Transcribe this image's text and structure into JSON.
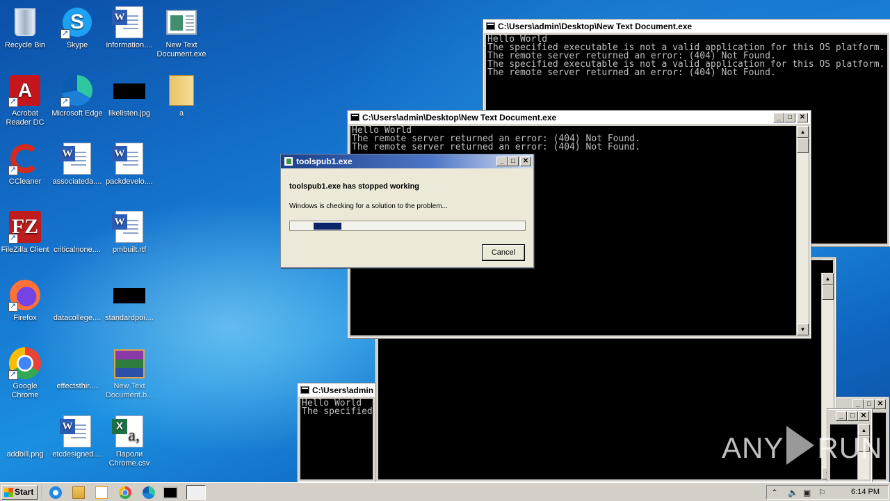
{
  "desktop": {
    "icons": [
      {
        "label": "Recycle Bin",
        "icon": "recycle-bin-icon"
      },
      {
        "label": "Skype",
        "icon": "skype-icon"
      },
      {
        "label": "information....",
        "icon": "word-document-icon"
      },
      {
        "label": "New Text Document.exe",
        "icon": "executable-icon"
      },
      {
        "label": "Acrobat Reader DC",
        "icon": "acrobat-icon"
      },
      {
        "label": "Microsoft Edge",
        "icon": "edge-icon"
      },
      {
        "label": "likelisten.jpg",
        "icon": "image-icon"
      },
      {
        "label": "a",
        "icon": "folder-icon"
      },
      {
        "label": "CCleaner",
        "icon": "ccleaner-icon"
      },
      {
        "label": "associateda....",
        "icon": "word-document-icon"
      },
      {
        "label": "packdevelo....",
        "icon": "word-document-icon"
      },
      {
        "label": "FileZilla Client",
        "icon": "filezilla-icon"
      },
      {
        "label": "criticalnone....",
        "icon": "blank-file-icon"
      },
      {
        "label": "pmbuilt.rtf",
        "icon": "word-document-icon"
      },
      {
        "label": "Firefox",
        "icon": "firefox-icon"
      },
      {
        "label": "datacollege....",
        "icon": "blank-file-icon"
      },
      {
        "label": "standardpoi....",
        "icon": "image-icon"
      },
      {
        "label": "Google Chrome",
        "icon": "chrome-icon"
      },
      {
        "label": "effectsthir....",
        "icon": "blank-file-icon"
      },
      {
        "label": "New Text Document.b...",
        "icon": "winrar-icon"
      },
      {
        "label": "addbill.png",
        "icon": "blank-file-icon"
      },
      {
        "label": "etcdesigned....",
        "icon": "word-document-icon"
      },
      {
        "label": "Пароли Chrome.csv",
        "icon": "excel-csv-icon"
      }
    ]
  },
  "consoles": [
    {
      "title": "C:\\Users\\admin\\Desktop\\New Text Document.exe",
      "lines": "Hello World\nThe specified executable is not a valid application for this OS platform.\nThe remote server returned an error: (404) Not Found.\nThe specified executable is not a valid application for this OS platform.\nThe remote server returned an error: (404) Not Found."
    },
    {
      "title": "C:\\Users\\admin\\Desktop\\New Text Document.exe",
      "lines": "Hello World\nThe remote server returned an error: (404) Not Found.\nThe remote server returned an error: (404) Not Found."
    },
    {
      "title": "C:\\Users\\admin",
      "lines": "Hello World\nThe specified"
    }
  ],
  "window_buttons": {
    "minimize": "_",
    "maximize": "□",
    "close": "✕"
  },
  "dialog": {
    "title": "toolspub1.exe",
    "heading": "toolspub1.exe has stopped working",
    "message": "Windows is checking for a solution to the problem...",
    "cancel_label": "Cancel"
  },
  "watermark": {
    "left": "ANY",
    "right": "RUN"
  },
  "taskbar": {
    "start_label": "Start",
    "clock": "6:14 PM"
  }
}
